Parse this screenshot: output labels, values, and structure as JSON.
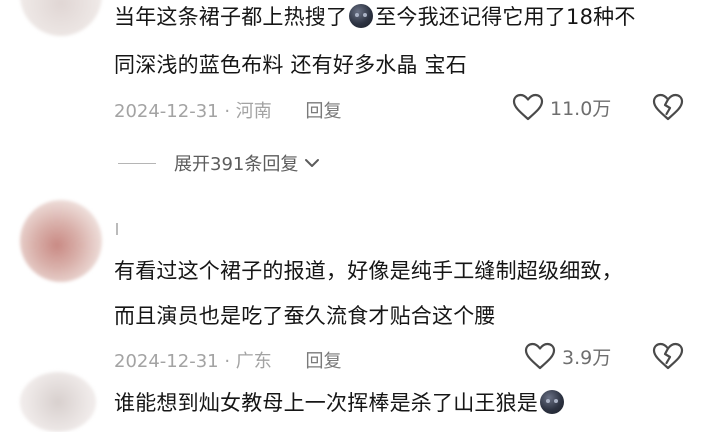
{
  "comments": [
    {
      "text_line1_a": "当年这条裙子都上热搜了",
      "text_line1_b": "至今我还记得它用了18种不",
      "text_line2": "同深浅的蓝色布料 还有好多水晶 宝石",
      "date": "2024-12-31",
      "location": "· 河南",
      "reply_label": "回复",
      "likes": "11.0万",
      "expand_label": "展开391条回复"
    },
    {
      "text_line1": "有看过这个裙子的报道，好像是纯手工缝制超级细致，",
      "text_line2": "而且演员也是吃了蚕久流食才贴合这个腰",
      "date": "2024-12-31",
      "location": "· 广东",
      "reply_label": "回复",
      "likes": "3.9万"
    },
    {
      "text_line1": "谁能想到灿女教母上一次挥棒是杀了山王狼是"
    }
  ],
  "icons": {
    "emoji": "dark-face-emoji-icon",
    "like": "heart-outline-icon",
    "dislike": "broken-heart-icon",
    "expand": "chevron-down-icon"
  }
}
